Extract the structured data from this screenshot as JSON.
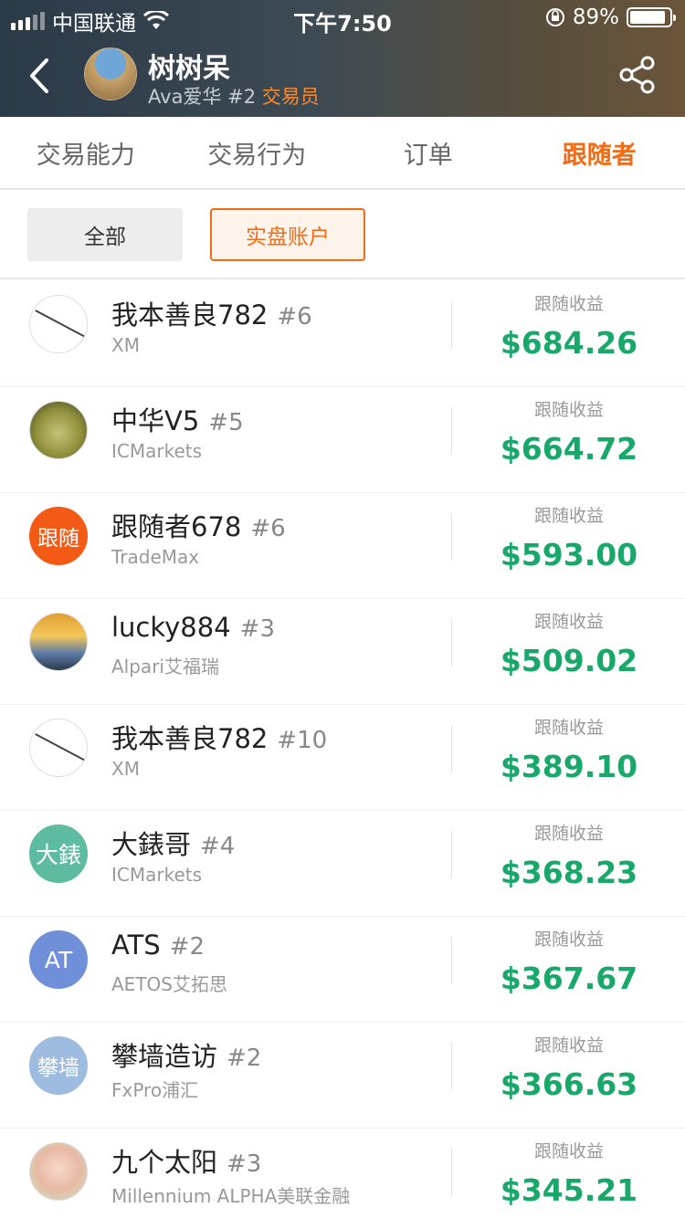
{
  "status_bar": {
    "carrier": "中国联通",
    "time": "下午7:50",
    "battery": "89%"
  },
  "header": {
    "name": "树树呆",
    "sub_prefix": "Ava爱华 #2",
    "role": "交易员"
  },
  "tabs": [
    {
      "label": "交易能力"
    },
    {
      "label": "交易行为"
    },
    {
      "label": "订单"
    },
    {
      "label": "跟随者"
    }
  ],
  "filters": {
    "all": "全部",
    "real": "实盘账户"
  },
  "followers": [
    {
      "name": "我本善良782",
      "rank": "#6",
      "broker": "XM",
      "pl_label": "跟随收益",
      "pl": "$684.26",
      "avatar_text": ""
    },
    {
      "name": "中华V5",
      "rank": "#5",
      "broker": "ICMarkets",
      "pl_label": "跟随收益",
      "pl": "$664.72",
      "avatar_text": ""
    },
    {
      "name": "跟随者678",
      "rank": "#6",
      "broker": "TradeMax",
      "pl_label": "跟随收益",
      "pl": "$593.00",
      "avatar_text": "跟随"
    },
    {
      "name": "lucky884",
      "rank": "#3",
      "broker": "Alpari艾福瑞",
      "pl_label": "跟随收益",
      "pl": "$509.02",
      "avatar_text": ""
    },
    {
      "name": "我本善良782",
      "rank": "#10",
      "broker": "XM",
      "pl_label": "跟随收益",
      "pl": "$389.10",
      "avatar_text": ""
    },
    {
      "name": "大錶哥",
      "rank": "#4",
      "broker": "ICMarkets",
      "pl_label": "跟随收益",
      "pl": "$368.23",
      "avatar_text": "大錶"
    },
    {
      "name": "ATS",
      "rank": "#2",
      "broker": "AETOS艾拓思",
      "pl_label": "跟随收益",
      "pl": "$367.67",
      "avatar_text": "AT"
    },
    {
      "name": "攀墙造访",
      "rank": "#2",
      "broker": "FxPro浦汇",
      "pl_label": "跟随收益",
      "pl": "$366.63",
      "avatar_text": "攀墙"
    },
    {
      "name": "九个太阳",
      "rank": "#3",
      "broker": "Millennium ALPHA美联金融",
      "pl_label": "跟随收益",
      "pl": "$345.21",
      "avatar_text": ""
    }
  ],
  "colors": {
    "accent": "#f36b14",
    "profit": "#18a86a"
  }
}
